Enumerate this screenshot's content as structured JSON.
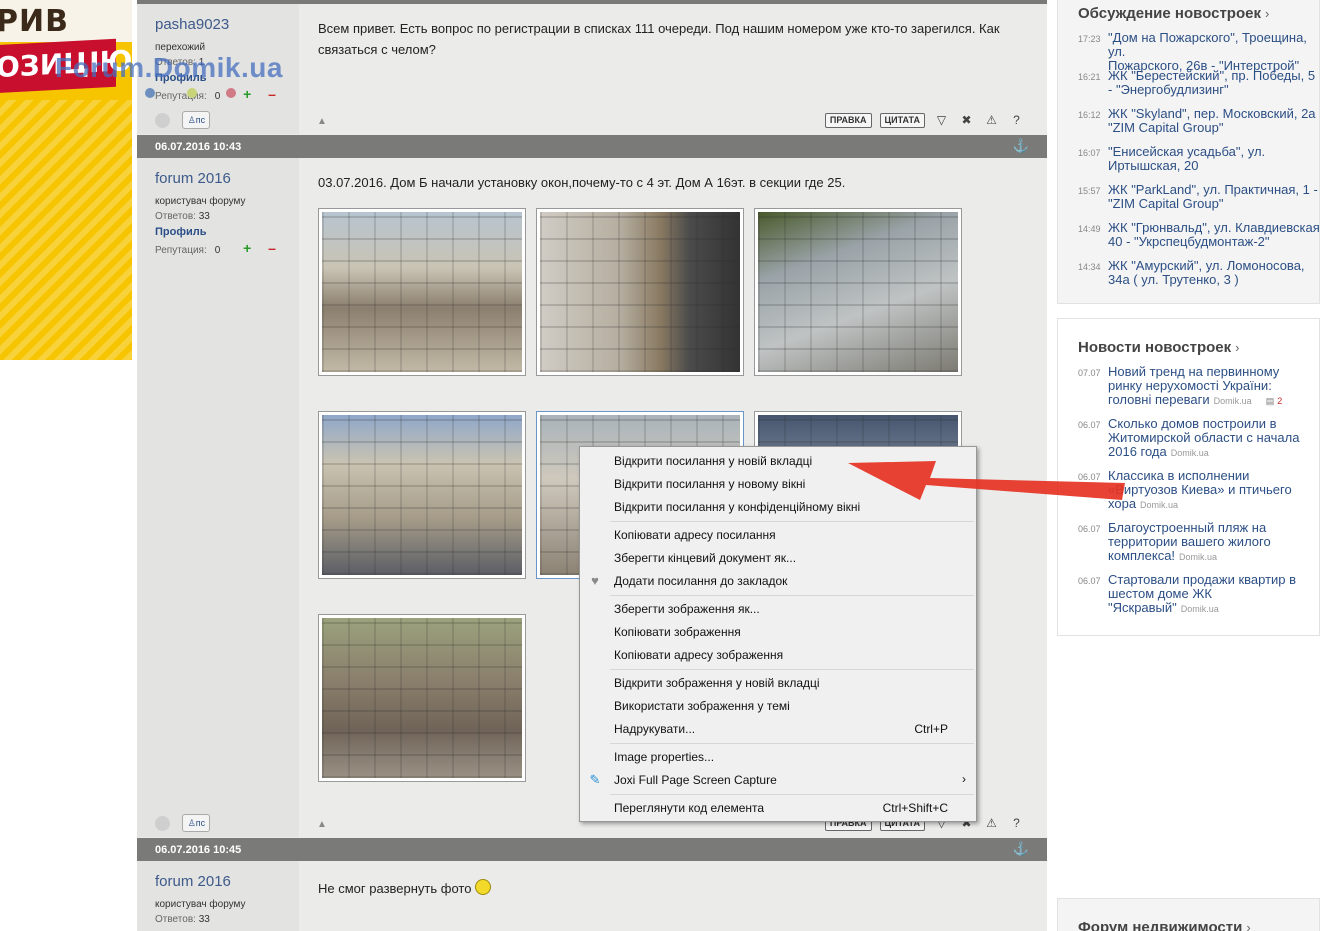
{
  "banner": {
    "line1": "РИВ",
    "line2": "ОЗИЦІЮ"
  },
  "watermark": "Forum.Domik.ua",
  "posts": [
    {
      "author": "pasha9023",
      "role": "перехожий",
      "answers_label": "Ответов:",
      "answers": "1",
      "profile": "Профиль",
      "rep_label": "Репутация:",
      "rep": "0",
      "text": "Всем привет. Есть вопрос по регистрации в списках 111 очереди. Под нашим номером уже кто-то зарегился. Как связаться с челом?",
      "pm": "пс",
      "edit_btn": "ПРАВКА",
      "quote_btn": "ЦИТАТА"
    },
    {
      "date": "06.07.2016 10:43",
      "author": "forum 2016",
      "role": "користувач форуму",
      "answers_label": "Ответов:",
      "answers": "33",
      "profile": "Профиль",
      "rep_label": "Репутация:",
      "rep": "0",
      "text": "03.07.2016. Дом Б начали установку окон,почему-то с 4 эт. Дом А 16эт. в секции где 25.",
      "pm": "пс",
      "edit_btn": "ПРАВКА",
      "quote_btn": "ЦИТАТА"
    },
    {
      "date": "06.07.2016 10:45",
      "author": "forum 2016",
      "role": "користувач форуму",
      "answers_label": "Ответов:",
      "answers": "33",
      "text": "Не смог развернуть фото"
    }
  ],
  "sidebar": {
    "discussion": {
      "title": "Обсуждение новостроек",
      "items": [
        {
          "time": "17:23",
          "text": "\"Дом на Пожарского\", Троещина, ул.\nПожарского, 26в - \"Интерстрой\""
        },
        {
          "time": "16:21",
          "text": "ЖК \"Берестейский\", пр. Победы, 5\n- \"Энергобудлизинг\""
        },
        {
          "time": "16:12",
          "text": "ЖК \"Skyland\", пер. Московский, 2а\n\"ZIM Capital Group\""
        },
        {
          "time": "16:07",
          "text": "\"Енисейская усадьба\", ул.\nИртышская, 20"
        },
        {
          "time": "15:57",
          "text": "ЖК \"ParkLand\", ул. Практичная, 1 -\n\"ZIM Capital Group\""
        },
        {
          "time": "14:49",
          "text": "ЖК \"Грюнвальд\", ул. Клавдиевская\n40 - \"Укрспецбудмонтаж-2\""
        },
        {
          "time": "14:34",
          "text": "ЖК \"Амурский\", ул. Ломоносова,\n34а ( ул. Трутенко, 3 )"
        }
      ]
    },
    "news": {
      "title": "Новости новостроек",
      "items": [
        {
          "date": "07.07",
          "text": "Новий тренд на первинному\nринку нерухомості України:\nголовні переваги",
          "source": "Domik.ua",
          "comments": "2"
        },
        {
          "date": "06.07",
          "text": "Сколько домов построили в\nЖитомирской области с начала\n2016 года",
          "source": "Domik.ua"
        },
        {
          "date": "06.07",
          "text": "Классика в исполнении\n«Виртуозов Киева» и птичьего\nхора",
          "source": "Domik.ua"
        },
        {
          "date": "06.07",
          "text": "Благоустроенный пляж на\nтерритории вашего жилого\nкомплекса!",
          "source": "Domik.ua"
        },
        {
          "date": "06.07",
          "text": "Стартовали продажи квартир в\nшестом доме ЖК\n\"Яскравый\"",
          "source": "Domik.ua"
        }
      ]
    },
    "forum_title": "Форум недвижимости"
  },
  "context_menu": {
    "items": [
      {
        "label": "Відкрити посилання у новій вкладці"
      },
      {
        "label": "Відкрити посилання у новому вікні"
      },
      {
        "label": "Відкрити посилання у конфіденційному вікні"
      },
      {
        "label": "Копіювати адресу посилання"
      },
      {
        "label": "Зберегти кінцевий документ як..."
      },
      {
        "label": "Додати посилання до закладок"
      },
      {
        "label": "Зберегти зображення як..."
      },
      {
        "label": "Копіювати зображення"
      },
      {
        "label": "Копіювати адресу зображення"
      },
      {
        "label": "Відкрити зображення у новій вкладці"
      },
      {
        "label": "Використати зображення у темі"
      },
      {
        "label": "Надрукувати...",
        "shortcut": "Ctrl+P"
      },
      {
        "label": "Image properties..."
      },
      {
        "label": "Joxi Full Page Screen Capture",
        "submenu": "›"
      },
      {
        "label": "Переглянути код елемента",
        "shortcut": "Ctrl+Shift+C"
      }
    ]
  },
  "colors": {
    "accent_link": "#2c4f85",
    "header_bar": "#7a7a79",
    "arrow": "#e53222"
  }
}
